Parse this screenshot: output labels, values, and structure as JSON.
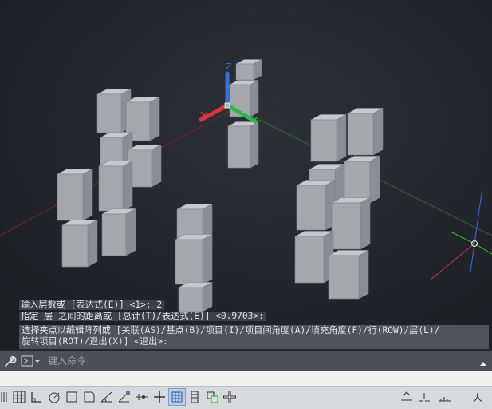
{
  "command_history": {
    "line1": "输入层数或 [表达式(E)] <1>: 2",
    "line2": "指定 层 之间的距离或 [总计(T)/表达式(E)] <0.9703>:",
    "line3": "选择夹点以编辑阵列或 [关联(AS)/基点(B)/项目(I)/项目间角度(A)/填充角度(F)/行(ROW)/层(L)/",
    "line4": "旋转项目(ROT)/退出(X)] <退出>:"
  },
  "command_line": {
    "placeholder": "键入命令",
    "prompt_icon": "command-prompt-icon",
    "settings_icon": "wrench-icon"
  },
  "ucs": {
    "z_label": "Z"
  },
  "status_bar": {
    "items": [
      "grid-icon",
      "snap-icon",
      "ortho-icon",
      "polar-icon",
      "isodraft-icon",
      "object-snap-icon",
      "3d-osnap-icon",
      "dynamic-ucs-icon",
      "object-snap-tracking-icon",
      "dynamic-input-icon",
      "lineweight-icon",
      "transparency-icon",
      "selection-cycling-icon",
      "annotation-monitor-icon",
      "gizmo-icon",
      "annotation-scale-icon",
      "visibility-icon",
      "autoscale-icon"
    ],
    "model_label": "人"
  },
  "colors": {
    "viewport_bg": "#22262c",
    "box_front": "#a3a8ad",
    "box_side": "#898e94",
    "box_top": "#c5c9cd",
    "x_axis": "#d9363a",
    "y_axis": "#2fb84a",
    "z_axis": "#3a6fd8"
  }
}
